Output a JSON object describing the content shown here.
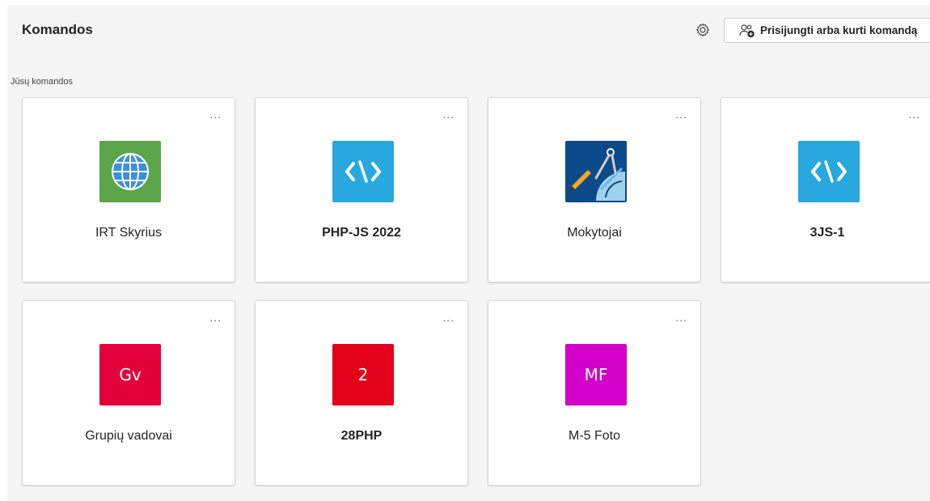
{
  "header": {
    "title": "Komandos",
    "join_button_label": "Prisijungti arba kurti komandą"
  },
  "section_label": "Jūsų komandos",
  "teams": [
    {
      "name": "IRT Skyrius",
      "bold": false,
      "logo": "globe-icon",
      "color": "#5ba64a",
      "initials": ""
    },
    {
      "name": "PHP-JS 2022",
      "bold": true,
      "logo": "code-icon",
      "color": "#29a8e0",
      "initials": ""
    },
    {
      "name": "Mokytojai",
      "bold": false,
      "logo": "geometry-tools-icon",
      "color": "#0d4a8a",
      "initials": ""
    },
    {
      "name": "3JS-1",
      "bold": true,
      "logo": "code-icon",
      "color": "#29a8e0",
      "initials": ""
    },
    {
      "name": "Grupių vadovai",
      "bold": false,
      "logo": "initials",
      "color": "#e4003a",
      "initials": "Gv"
    },
    {
      "name": "28PHP",
      "bold": true,
      "logo": "initials",
      "color": "#e3001b",
      "initials": "2"
    },
    {
      "name": "M-5 Foto",
      "bold": false,
      "logo": "initials",
      "color": "#d200c9",
      "initials": "MF"
    }
  ],
  "more_label": "..."
}
